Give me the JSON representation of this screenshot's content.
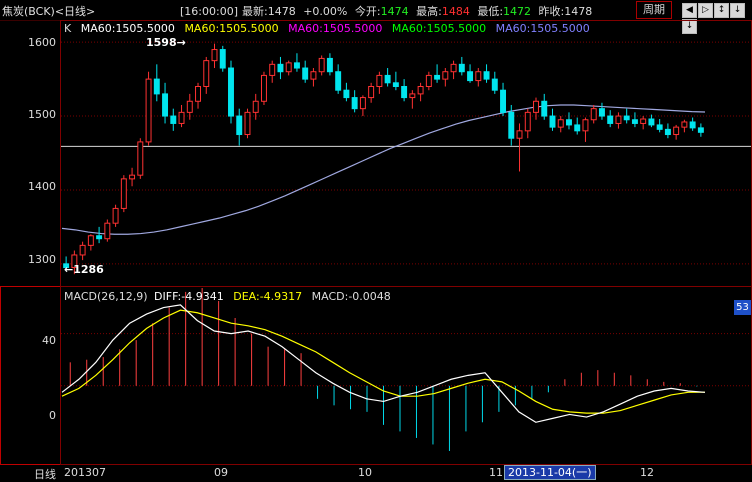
{
  "header": {
    "title": "焦炭(BCK)<日线>",
    "time": "[16:00:00]",
    "latest_label": "最新:",
    "latest": "1478",
    "change": "+0.00%",
    "open_label": "今开:",
    "open": "1474",
    "high_label": "最高:",
    "high": "1484",
    "low_label": "最低:",
    "low": "1472",
    "prev_label": "昨收:",
    "prev": "1478",
    "period_button": "周期",
    "nav_icons": [
      "◀",
      "▷",
      "↕",
      "↓",
      "↓"
    ]
  },
  "main_legend": {
    "prefix": "K",
    "items": [
      "MA60:1505.5000",
      "MA60:1505.5000",
      "MA60:1505.5000",
      "MA60:1505.5000",
      "MA60:1505.5000"
    ],
    "colors": [
      "#ffffff",
      "#ffff00",
      "#ff00ff",
      "#00ff00",
      "#8080ff"
    ]
  },
  "main_axis": {
    "ticks": [
      "1600",
      "1500",
      "1400",
      "1300"
    ]
  },
  "annotations": {
    "high": "1598→",
    "low": "←1286"
  },
  "macd_legend": {
    "title": "MACD(26,12,9)",
    "diff": "DIFF:-4.9341",
    "dea": "DEA:-4.9317",
    "macd": "MACD:-0.0048"
  },
  "macd_axis": {
    "ticks": [
      "40",
      "0"
    ]
  },
  "macd_badge": "53",
  "x_axis": {
    "period": "日线",
    "labels": [
      "201307",
      "09",
      "10",
      "11",
      "12"
    ],
    "selected_date": "2013-11-04(一)"
  },
  "chart_data": {
    "type": "candlestick",
    "ylim_main": [
      1270,
      1630
    ],
    "ylim_macd": [
      -60,
      75
    ],
    "ref_price": 1459,
    "candles": [
      [
        1300,
        1310,
        1290,
        1295
      ],
      [
        1295,
        1318,
        1286,
        1312
      ],
      [
        1312,
        1330,
        1305,
        1325
      ],
      [
        1325,
        1340,
        1318,
        1338
      ],
      [
        1338,
        1350,
        1328,
        1334
      ],
      [
        1334,
        1360,
        1330,
        1355
      ],
      [
        1355,
        1380,
        1350,
        1375
      ],
      [
        1375,
        1420,
        1370,
        1415
      ],
      [
        1415,
        1430,
        1405,
        1420
      ],
      [
        1420,
        1470,
        1415,
        1465
      ],
      [
        1465,
        1560,
        1460,
        1550
      ],
      [
        1550,
        1570,
        1520,
        1530
      ],
      [
        1530,
        1545,
        1490,
        1500
      ],
      [
        1500,
        1510,
        1480,
        1490
      ],
      [
        1490,
        1515,
        1485,
        1505
      ],
      [
        1505,
        1530,
        1495,
        1520
      ],
      [
        1520,
        1545,
        1510,
        1540
      ],
      [
        1540,
        1580,
        1530,
        1575
      ],
      [
        1575,
        1598,
        1565,
        1590
      ],
      [
        1590,
        1595,
        1560,
        1565
      ],
      [
        1565,
        1575,
        1490,
        1500
      ],
      [
        1500,
        1510,
        1460,
        1475
      ],
      [
        1475,
        1510,
        1470,
        1505
      ],
      [
        1505,
        1530,
        1495,
        1520
      ],
      [
        1520,
        1560,
        1515,
        1555
      ],
      [
        1555,
        1575,
        1545,
        1570
      ],
      [
        1570,
        1580,
        1550,
        1560
      ],
      [
        1560,
        1575,
        1555,
        1572
      ],
      [
        1572,
        1585,
        1560,
        1565
      ],
      [
        1565,
        1575,
        1545,
        1550
      ],
      [
        1550,
        1565,
        1540,
        1560
      ],
      [
        1560,
        1582,
        1555,
        1578
      ],
      [
        1578,
        1585,
        1555,
        1560
      ],
      [
        1560,
        1570,
        1530,
        1535
      ],
      [
        1535,
        1545,
        1520,
        1525
      ],
      [
        1525,
        1535,
        1505,
        1510
      ],
      [
        1510,
        1528,
        1500,
        1525
      ],
      [
        1525,
        1545,
        1518,
        1540
      ],
      [
        1540,
        1560,
        1530,
        1555
      ],
      [
        1555,
        1565,
        1540,
        1545
      ],
      [
        1545,
        1560,
        1535,
        1540
      ],
      [
        1540,
        1550,
        1520,
        1525
      ],
      [
        1525,
        1535,
        1510,
        1530
      ],
      [
        1530,
        1545,
        1520,
        1540
      ],
      [
        1540,
        1560,
        1535,
        1555
      ],
      [
        1555,
        1570,
        1545,
        1550
      ],
      [
        1550,
        1565,
        1540,
        1560
      ],
      [
        1560,
        1575,
        1550,
        1570
      ],
      [
        1570,
        1580,
        1555,
        1560
      ],
      [
        1560,
        1570,
        1545,
        1548
      ],
      [
        1548,
        1565,
        1540,
        1560
      ],
      [
        1560,
        1570,
        1545,
        1550
      ],
      [
        1550,
        1560,
        1530,
        1535
      ],
      [
        1535,
        1545,
        1500,
        1505
      ],
      [
        1505,
        1515,
        1460,
        1470
      ],
      [
        1470,
        1490,
        1425,
        1480
      ],
      [
        1480,
        1510,
        1470,
        1505
      ],
      [
        1505,
        1525,
        1495,
        1520
      ],
      [
        1520,
        1530,
        1495,
        1500
      ],
      [
        1500,
        1510,
        1480,
        1485
      ],
      [
        1485,
        1500,
        1478,
        1495
      ],
      [
        1495,
        1505,
        1482,
        1488
      ],
      [
        1488,
        1498,
        1475,
        1480
      ],
      [
        1480,
        1498,
        1465,
        1495
      ],
      [
        1495,
        1515,
        1490,
        1510
      ],
      [
        1510,
        1518,
        1495,
        1500
      ],
      [
        1500,
        1508,
        1485,
        1490
      ],
      [
        1490,
        1505,
        1483,
        1500
      ],
      [
        1500,
        1510,
        1490,
        1495
      ],
      [
        1495,
        1505,
        1485,
        1490
      ],
      [
        1490,
        1500,
        1482,
        1496
      ],
      [
        1496,
        1502,
        1485,
        1488
      ],
      [
        1488,
        1496,
        1478,
        1482
      ],
      [
        1482,
        1490,
        1470,
        1475
      ],
      [
        1475,
        1488,
        1468,
        1485
      ],
      [
        1485,
        1495,
        1478,
        1492
      ],
      [
        1492,
        1498,
        1480,
        1484
      ],
      [
        1484,
        1490,
        1472,
        1478
      ]
    ],
    "ma60": [
      1348,
      1346,
      1343,
      1341,
      1340,
      1340,
      1341,
      1343,
      1346,
      1350,
      1354,
      1358,
      1362,
      1367,
      1372,
      1378,
      1385,
      1392,
      1400,
      1408,
      1416,
      1424,
      1432,
      1440,
      1448,
      1456,
      1463,
      1470,
      1477,
      1483,
      1489,
      1494,
      1498,
      1502,
      1506,
      1509,
      1512,
      1514,
      1515,
      1515,
      1514,
      1513,
      1512,
      1511,
      1510,
      1509,
      1508,
      1507,
      1506,
      1505.5
    ],
    "macd_diff": [
      -5,
      5,
      18,
      35,
      48,
      55,
      60,
      62,
      50,
      42,
      40,
      42,
      38,
      30,
      20,
      10,
      2,
      -5,
      -10,
      -12,
      -8,
      -5,
      0,
      5,
      8,
      10,
      -5,
      -20,
      -28,
      -25,
      -22,
      -24,
      -20,
      -14,
      -8,
      -4,
      -2,
      -4,
      -5
    ],
    "macd_dea": [
      -8,
      -2,
      8,
      20,
      33,
      44,
      52,
      58,
      56,
      52,
      48,
      46,
      43,
      38,
      32,
      26,
      18,
      10,
      3,
      -4,
      -8,
      -8,
      -6,
      -2,
      2,
      5,
      3,
      -4,
      -12,
      -18,
      -20,
      -21,
      -21,
      -19,
      -15,
      -11,
      -7,
      -5,
      -4.9
    ],
    "macd_hist": [
      18,
      20,
      22,
      28,
      35,
      48,
      60,
      72,
      75,
      65,
      52,
      40,
      30,
      28,
      25,
      -10,
      -15,
      -18,
      -20,
      -30,
      -35,
      -40,
      -45,
      -50,
      -35,
      -28,
      -20,
      -15,
      -10,
      -5,
      5,
      10,
      12,
      10,
      8,
      5,
      3,
      2,
      -0.5
    ]
  }
}
